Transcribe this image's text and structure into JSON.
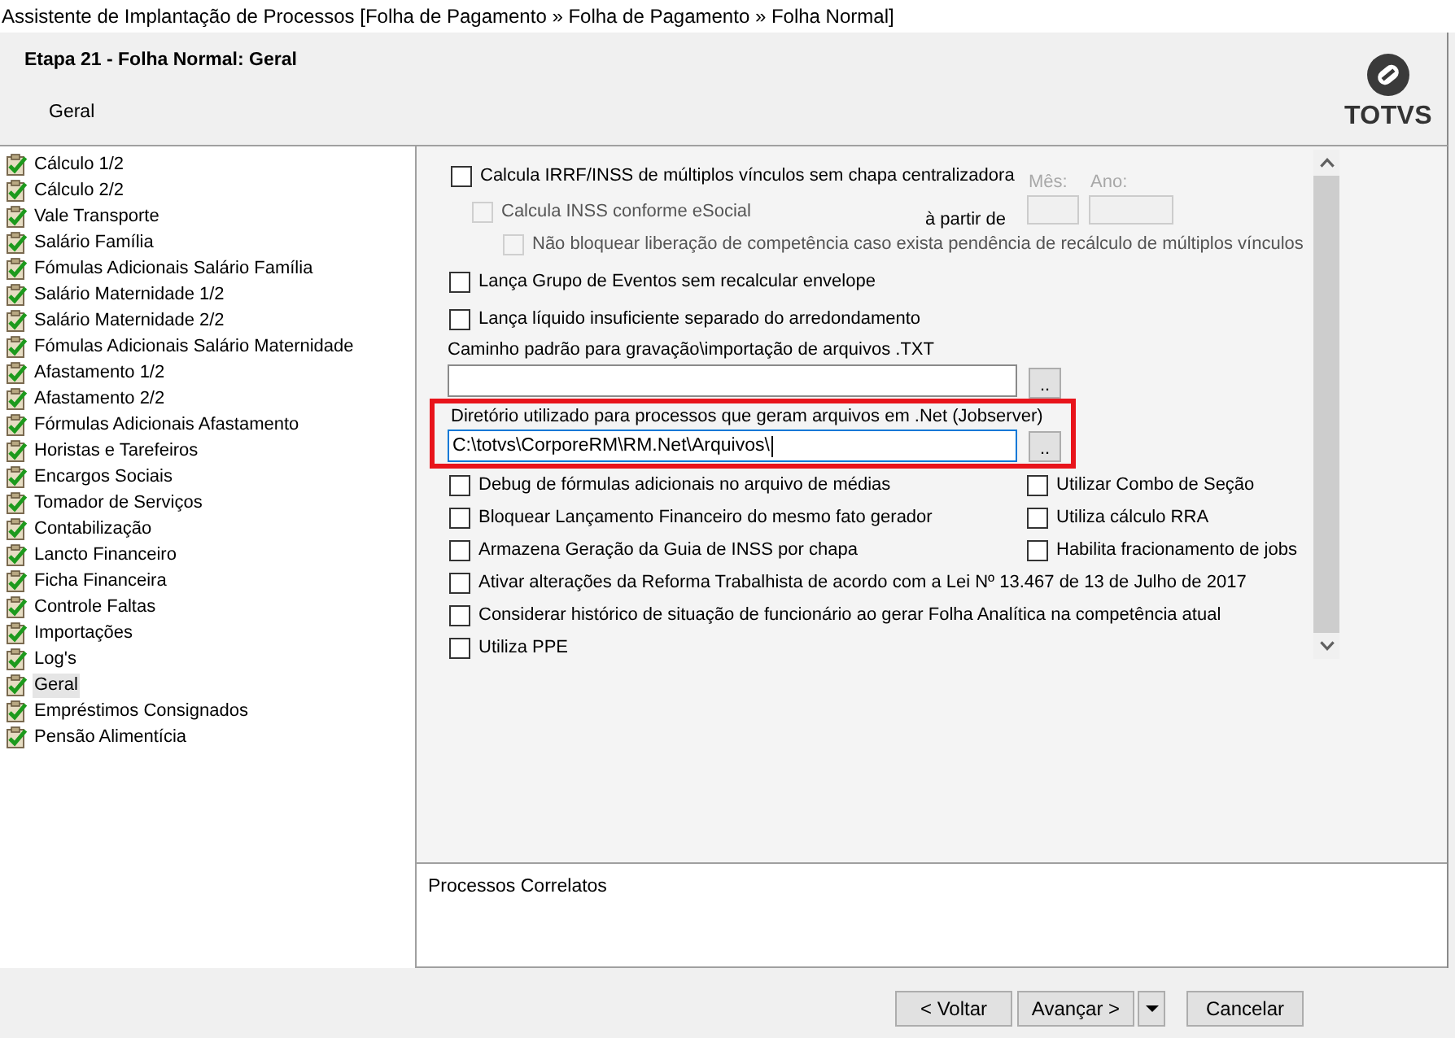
{
  "window": {
    "title": "Assistente de Implantação de Processos [Folha de Pagamento » Folha de Pagamento » Folha Normal]"
  },
  "header": {
    "title": "Etapa 21 - Folha Normal: Geral",
    "subtitle": "Geral",
    "logo_text": "TOTVS"
  },
  "steps": [
    {
      "label": "Cálculo 1/2",
      "done": true,
      "selected": false
    },
    {
      "label": "Cálculo 2/2",
      "done": true,
      "selected": false
    },
    {
      "label": "Vale Transporte",
      "done": true,
      "selected": false
    },
    {
      "label": "Salário Família",
      "done": true,
      "selected": false
    },
    {
      "label": "Fómulas Adicionais Salário Família",
      "done": true,
      "selected": false
    },
    {
      "label": "Salário Maternidade 1/2",
      "done": true,
      "selected": false
    },
    {
      "label": "Salário Maternidade 2/2",
      "done": true,
      "selected": false
    },
    {
      "label": "Fómulas Adicionais Salário Maternidade",
      "done": true,
      "selected": false
    },
    {
      "label": "Afastamento 1/2",
      "done": true,
      "selected": false
    },
    {
      "label": "Afastamento 2/2",
      "done": true,
      "selected": false
    },
    {
      "label": "Fórmulas Adicionais Afastamento",
      "done": true,
      "selected": false
    },
    {
      "label": "Horistas e Tarefeiros",
      "done": true,
      "selected": false
    },
    {
      "label": "Encargos Sociais",
      "done": true,
      "selected": false
    },
    {
      "label": "Tomador de Serviços",
      "done": true,
      "selected": false
    },
    {
      "label": "Contabilização",
      "done": true,
      "selected": false
    },
    {
      "label": "Lancto Financeiro",
      "done": true,
      "selected": false
    },
    {
      "label": "Ficha Financeira",
      "done": true,
      "selected": false
    },
    {
      "label": "Controle Faltas",
      "done": true,
      "selected": false
    },
    {
      "label": "Importações",
      "done": true,
      "selected": false
    },
    {
      "label": "Log's",
      "done": true,
      "selected": false
    },
    {
      "label": "Geral",
      "done": true,
      "selected": true
    },
    {
      "label": "Empréstimos Consignados",
      "done": true,
      "selected": false
    },
    {
      "label": "Pensão Alimentícia",
      "done": true,
      "selected": false
    }
  ],
  "settings": {
    "multi_link": {
      "label": "Calcula IRRF/INSS de múltiplos vínculos sem chapa centralizadora",
      "checked": false,
      "disabled": false
    },
    "esocial": {
      "label": "Calcula INSS conforme eSocial",
      "checked": false,
      "disabled": true
    },
    "start": {
      "label": "à partir de",
      "month": {
        "label": "Mês:",
        "disabled": true
      },
      "year": {
        "label": "Ano:",
        "disabled": true
      }
    },
    "no_block": {
      "label": "Não bloquear liberação de competência caso exista pendência de recálculo de múltiplos vínculos",
      "checked": false,
      "disabled": true
    },
    "options_a": [
      {
        "label": "Lança Grupo de Eventos sem recalcular envelope",
        "checked": false
      },
      {
        "label": "Lança líquido insuficiente separado do arredondamento",
        "checked": false
      }
    ],
    "txt_path": {
      "label": "Caminho padrão para gravação\\importação de arquivos .TXT",
      "browse": ".."
    },
    "jobserver_path": {
      "label": "Diretório utilizado para processos que geram arquivos em .Net (Jobserver)",
      "value": "C:\\totvs\\CorporeRM\\RM.Net\\Arquivos\\",
      "focused": true,
      "highlighted": true,
      "browse": ".."
    },
    "options_left": [
      {
        "label": "Debug de fórmulas adicionais no arquivo de médias",
        "checked": false
      },
      {
        "label": "Bloquear Lançamento Financeiro do mesmo fato gerador",
        "checked": false
      },
      {
        "label": "Armazena Geração da Guia de INSS por chapa",
        "checked": false
      }
    ],
    "options_right": [
      {
        "label": "Utilizar Combo de Seção",
        "checked": false
      },
      {
        "label": "Utiliza cálculo RRA",
        "checked": false
      },
      {
        "label": "Habilita fracionamento de jobs",
        "checked": false
      }
    ],
    "options_b": [
      {
        "label": "Ativar alterações da Reforma Trabalhista de acordo com a Lei Nº 13.467 de 13 de Julho de 2017",
        "checked": false
      },
      {
        "label": "Considerar histórico de situação de funcionário ao gerar Folha Analítica na competência atual",
        "checked": false
      },
      {
        "label": "Utiliza PPE",
        "checked": false
      }
    ]
  },
  "related": {
    "title": "Processos Correlatos"
  },
  "buttons": [
    {
      "kind": "button",
      "label": "< Voltar"
    },
    {
      "kind": "button",
      "label": "Avançar >"
    },
    {
      "kind": "dropdown"
    },
    {
      "kind": "button",
      "label": "Cancelar"
    }
  ]
}
